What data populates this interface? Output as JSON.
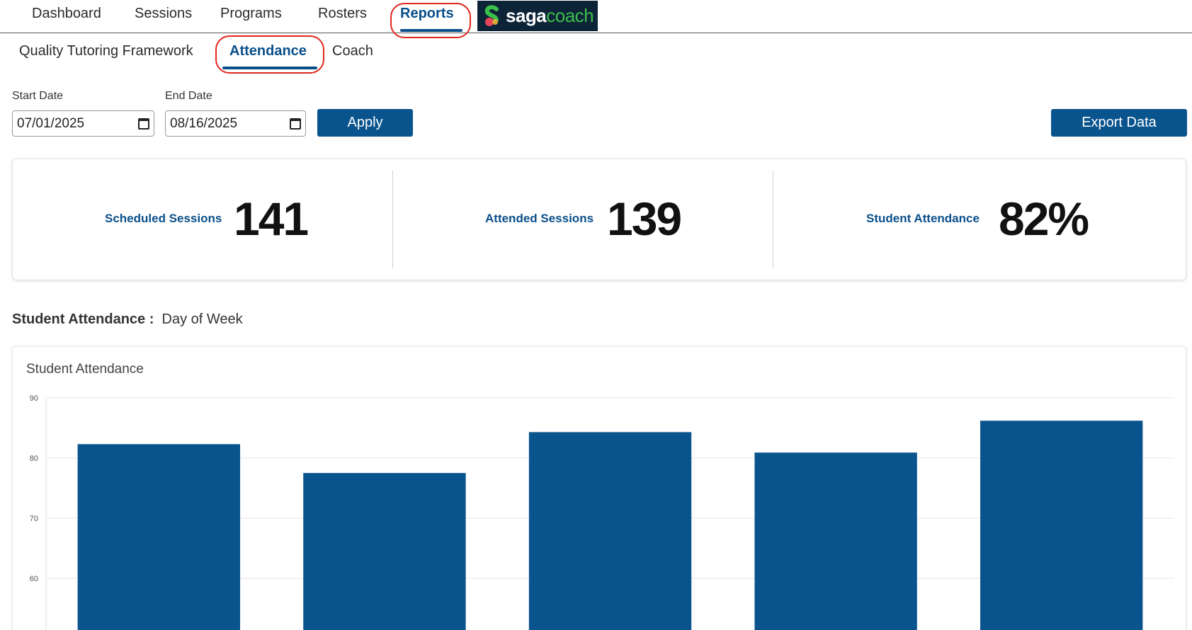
{
  "topnav": {
    "items": [
      "Dashboard",
      "Sessions",
      "Programs",
      "Rosters",
      "Reports"
    ],
    "active": "Reports",
    "logo": {
      "part1": "saga",
      "part2": "coach"
    }
  },
  "subnav": {
    "items": [
      "Quality Tutoring Framework",
      "Attendance",
      "Coach"
    ],
    "active": "Attendance"
  },
  "filters": {
    "start_label": "Start Date",
    "start_value": "07/01/2025",
    "end_label": "End Date",
    "end_value": "08/16/2025",
    "apply_label": "Apply",
    "export_label": "Export Data"
  },
  "kpis": [
    {
      "label": "Scheduled Sessions",
      "value": "141"
    },
    {
      "label": "Attended Sessions",
      "value": "139"
    },
    {
      "label": "Student Attendance",
      "value": "82%"
    }
  ],
  "section": {
    "title": "Student Attendance :",
    "subtitle": "Day of Week"
  },
  "colors": {
    "accent": "#0a548e",
    "annotation": "#e3261c"
  },
  "chart_data": {
    "type": "bar",
    "title": "Student Attendance",
    "xlabel": "",
    "ylabel": "",
    "y_ticks": [
      60,
      70,
      80,
      90
    ],
    "ylim": [
      55,
      90
    ],
    "values": [
      82.3,
      77.5,
      84.3,
      80.9,
      86.2
    ],
    "grid": true,
    "bar_color": "#0a548e"
  }
}
